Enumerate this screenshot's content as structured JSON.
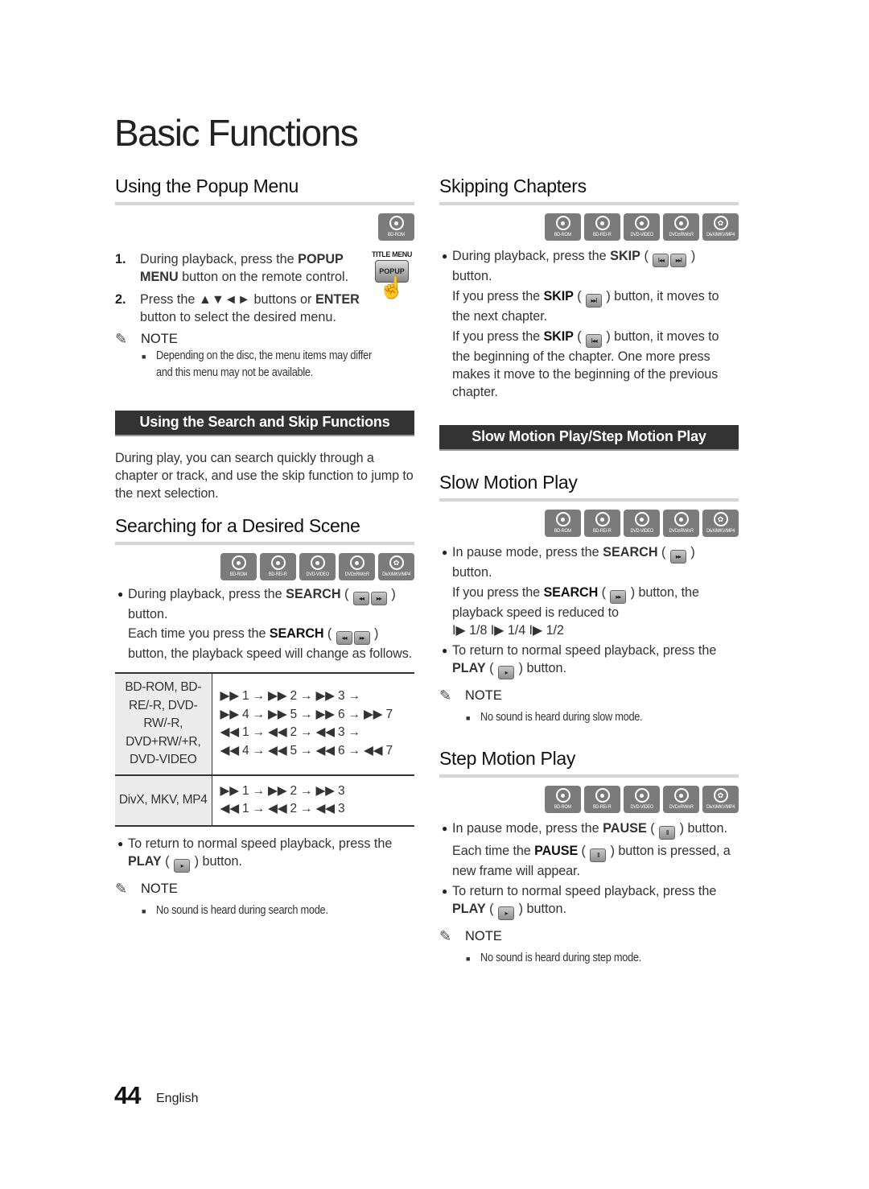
{
  "page": {
    "title": "Basic Functions",
    "page_number": "44",
    "language": "English"
  },
  "disc_badges": {
    "bd_rom": "BD-ROM",
    "bd_re": "BD-RE/-R",
    "dvd_video": "DVD-VIDEO",
    "dvd_rw": "DVD±RW/±R",
    "divx": "DivX/MKV/MP4"
  },
  "popup_menu": {
    "heading": "Using the Popup Menu",
    "remote_label": "TITLE MENU",
    "remote_button": "POPUP",
    "steps": [
      {
        "num": "1.",
        "pre": "During playback, press the ",
        "bold": "POPUP MENU",
        "post": " button on the remote control."
      },
      {
        "num": "2.",
        "pre": "Press the ▲▼◄► buttons or ",
        "bold": "ENTER",
        "post": " button to select the desired menu."
      }
    ],
    "note_label": "NOTE",
    "note": "Depending on the disc, the menu items may differ and this menu may not be available."
  },
  "search_skip": {
    "bar_heading": "Using the Search and Skip Functions",
    "intro": "During play, you can search quickly through a chapter or track, and use the skip function to jump to the next selection."
  },
  "searching_scene": {
    "heading": "Searching for a Desired Scene",
    "bullet1_pre": "During playback, press the ",
    "bullet1_bold": "SEARCH",
    "bullet1_post": " button.",
    "para_pre": "Each time you press the ",
    "para_bold": "SEARCH",
    "para_post": " button, the playback speed will change as follows.",
    "table": [
      {
        "formats": "BD-ROM, BD-RE/-R, DVD-RW/-R, DVD+RW/+R, DVD-VIDEO",
        "lines": [
          "▶▶ 1 → ▶▶ 2 → ▶▶ 3 →",
          "▶▶ 4 → ▶▶ 5 → ▶▶ 6 → ▶▶ 7",
          "◀◀ 1 → ◀◀ 2 → ◀◀ 3 →",
          "◀◀ 4 → ◀◀ 5 → ◀◀ 6 → ◀◀ 7"
        ]
      },
      {
        "formats": "DivX, MKV, MP4",
        "lines": [
          "▶▶ 1 → ▶▶ 2 → ▶▶ 3",
          "◀◀ 1 → ◀◀ 2 → ◀◀ 3"
        ]
      }
    ],
    "return_pre": "To return to normal speed playback, press the ",
    "return_bold": "PLAY",
    "return_post": " button.",
    "note_label": "NOTE",
    "note": "No sound is heard during search mode."
  },
  "skipping": {
    "heading": "Skipping Chapters",
    "bullet_pre": "During playback, press the ",
    "bullet_bold": "SKIP",
    "bullet_post": " button.",
    "next_pre": "If you press the ",
    "next_bold": "SKIP",
    "next_post": " button, it moves to the next chapter.",
    "prev_pre": "If you press the ",
    "prev_bold": "SKIP",
    "prev_post": " button, it moves to the beginning of the chapter. One more press makes it move to the beginning of the previous chapter."
  },
  "slow_step": {
    "bar_heading": "Slow Motion Play/Step Motion Play"
  },
  "slow_motion": {
    "heading": "Slow Motion Play",
    "bullet_pre": "In pause mode, press the ",
    "bullet_bold": "SEARCH",
    "bullet_post": " button.",
    "para_pre": "If you press the ",
    "para_bold": "SEARCH",
    "para_post": " button, the playback speed is reduced to",
    "speeds": "I▶ 1/8 I▶ 1/4 I▶ 1/2",
    "return_pre": "To return to normal speed playback, press the ",
    "return_bold": "PLAY",
    "return_post": " button.",
    "note_label": "NOTE",
    "note": "No sound is heard during slow mode."
  },
  "step_motion": {
    "heading": "Step Motion Play",
    "bullet_pre": "In pause mode, press the ",
    "bullet_bold": "PAUSE",
    "bullet_post": " button.",
    "para_pre": "Each time the ",
    "para_bold": "PAUSE",
    "para_post": " button is pressed, a new frame will appear.",
    "return_pre": "To return to normal speed playback, press the ",
    "return_bold": "PLAY",
    "return_post": " button.",
    "note_label": "NOTE",
    "note": "No sound is heard during step mode."
  },
  "key_glyphs": {
    "rew": "◂◂",
    "ff": "▸▸",
    "skip_prev": "I◂◂",
    "skip_next": "▸▸I",
    "play": "▸",
    "pause": "II"
  }
}
